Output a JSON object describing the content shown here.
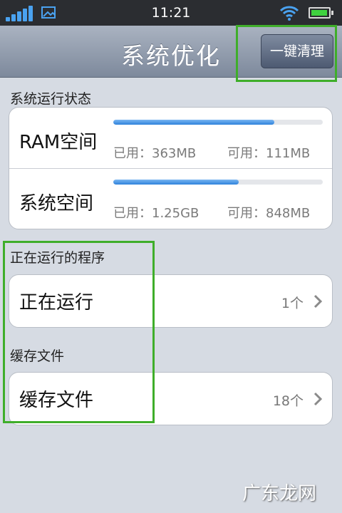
{
  "status_bar": {
    "time": "11:21",
    "signal_icon": "signal-bars-icon",
    "photo_icon": "image-icon",
    "wifi_icon": "wifi-icon",
    "battery_icon": "battery-icon",
    "battery_level": 0.95,
    "accent": "#4aa2f0"
  },
  "nav": {
    "title": "系统优化",
    "clean_button": "一键清理"
  },
  "status_section": {
    "label": "系统运行状态",
    "ram": {
      "title": "RAM空间",
      "used": "已用：363MB",
      "free": "可用：111MB",
      "fill": 0.77
    },
    "system": {
      "title": "系统空间",
      "used": "已用：1.25GB",
      "free": "可用：848MB",
      "fill": 0.6
    }
  },
  "running_section": {
    "label": "正在运行的程序",
    "row_title": "正在运行",
    "count": "1个"
  },
  "cache_section": {
    "label": "缓存文件",
    "row_title": "缓存文件",
    "count": "18个"
  },
  "watermark": "广东龙网",
  "highlight_color": "#3fae2a"
}
